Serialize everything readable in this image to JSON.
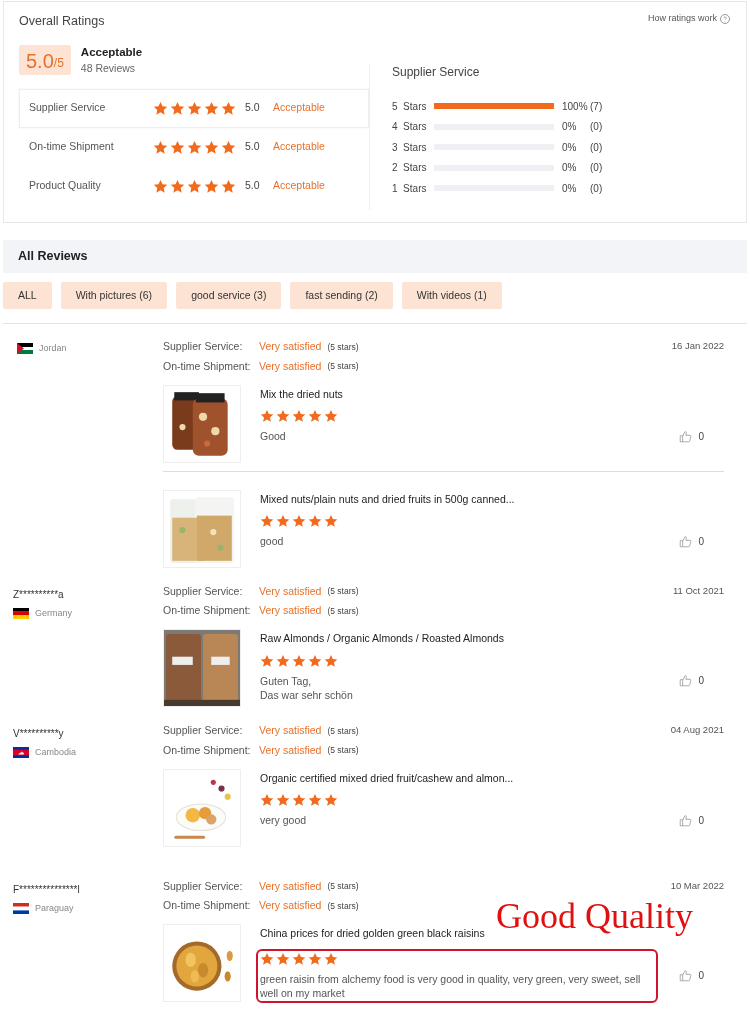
{
  "overall": {
    "title": "Overall Ratings",
    "help_link": "How ratings work",
    "score": "5.0",
    "score_max": "/5",
    "verdict": "Acceptable",
    "review_count": "48 Reviews",
    "categories": [
      {
        "label": "Supplier Service",
        "stars": 5,
        "score": "5.0",
        "verdict": "Acceptable",
        "selected": true
      },
      {
        "label": "On-time Shipment",
        "stars": 5,
        "score": "5.0",
        "verdict": "Acceptable",
        "selected": false
      },
      {
        "label": "Product Quality",
        "stars": 5,
        "score": "5.0",
        "verdict": "Acceptable",
        "selected": false
      }
    ],
    "breakdown_title": "Supplier Service",
    "breakdown": [
      {
        "label": "5  Stars",
        "level": 1,
        "percent": "100%",
        "count": "(7)"
      },
      {
        "label": "4  Stars",
        "level": 0,
        "percent": "0%",
        "count": "(0)"
      },
      {
        "label": "3  Stars",
        "level": 0,
        "percent": "0%",
        "count": "(0)"
      },
      {
        "label": "2  Stars",
        "level": 0,
        "percent": "0%",
        "count": "(0)"
      },
      {
        "label": "1  Stars",
        "level": 0,
        "percent": "0%",
        "count": "(0)"
      }
    ]
  },
  "all_reviews": {
    "title": "All Reviews",
    "filters": [
      {
        "label": "ALL",
        "selected": false
      },
      {
        "label": "With pictures (6)",
        "selected": false
      },
      {
        "label": "good service (3)",
        "selected": false
      },
      {
        "label": "fast sending (2)",
        "selected": false
      },
      {
        "label": "With videos (1)",
        "selected": false
      }
    ]
  },
  "reviews": [
    {
      "country": "Jordan",
      "date": "16 Jan 2022",
      "ratings": [
        {
          "label": "Supplier Service:",
          "value": "Very satisfied",
          "note": "(5 stars)"
        },
        {
          "label": "On-time Shipment:",
          "value": "Very satisfied",
          "note": "(5 stars)"
        }
      ],
      "products": [
        {
          "title": "Mix the dried nuts",
          "stars": 5,
          "comment": "Good",
          "likes": "0",
          "highlighted": false
        },
        {
          "title": "Mixed nuts/plain nuts and dried fruits in 500g canned...",
          "stars": 5,
          "comment": "good",
          "likes": "0",
          "highlighted": false
        }
      ]
    },
    {
      "user": "Z**********a",
      "country": "Germany",
      "date": "11 Oct 2021",
      "ratings": [
        {
          "label": "Supplier Service:",
          "value": "Very satisfied",
          "note": "(5 stars)"
        },
        {
          "label": "On-time Shipment:",
          "value": "Very satisfied",
          "note": "(5 stars)"
        }
      ],
      "products": [
        {
          "title": "Raw Almonds / Organic Almonds / Roasted Almonds",
          "stars": 5,
          "comment": "Guten Tag,\nDas war sehr schön",
          "likes": "0",
          "highlighted": false
        }
      ]
    },
    {
      "user": "V**********y",
      "country": "Cambodia",
      "date": "04 Aug 2021",
      "ratings": [
        {
          "label": "Supplier Service:",
          "value": "Very satisfied",
          "note": "(5 stars)"
        },
        {
          "label": "On-time Shipment:",
          "value": "Very satisfied",
          "note": "(5 stars)"
        }
      ],
      "products": [
        {
          "title": "Organic certified mixed dried fruit/cashew and almon...",
          "stars": 5,
          "comment": "very good",
          "likes": "0",
          "highlighted": false
        }
      ]
    },
    {
      "user": "F***************l",
      "country": "Paraguay",
      "date": "10 Mar 2022",
      "ratings": [
        {
          "label": "Supplier Service:",
          "value": "Very satisfied",
          "note": "(5 stars)"
        },
        {
          "label": "On-time Shipment:",
          "value": "Very satisfied",
          "note": "(5 stars)"
        }
      ],
      "products": [
        {
          "title": "China prices for dried golden green black raisins",
          "stars": 5,
          "comment": "green raisin from alchemy food is very good in quality, very green, very sweet, sell well on my market",
          "likes": "0",
          "highlighted": true
        }
      ]
    }
  ],
  "annotation": {
    "text": "Good Quality"
  }
}
